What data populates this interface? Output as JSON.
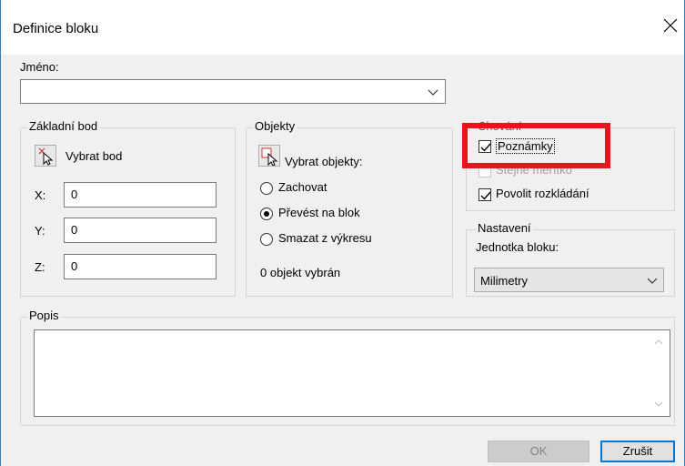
{
  "window": {
    "title": "Definice bloku",
    "close_icon": "close-icon"
  },
  "name_field": {
    "label": "Jméno:",
    "value": ""
  },
  "base_point": {
    "group_label": "Základní bod",
    "pick_label": "Vybrat bod",
    "x_label": "X:",
    "x_value": "0",
    "y_label": "Y:",
    "y_value": "0",
    "z_label": "Z:",
    "z_value": "0"
  },
  "objects": {
    "group_label": "Objekty",
    "select_label": "Vybrat objekty:",
    "options": [
      "Zachovat",
      "Převést na blok",
      "Smazat z výkresu"
    ],
    "selected_option": "Převést na blok",
    "status": "0 objekt vybrán"
  },
  "behavior": {
    "group_label": "Chování",
    "annotative_label": "Poznámky",
    "annotative_checked": true,
    "uniform_scale_label": "Stejné měřítko",
    "uniform_scale_enabled": false,
    "explode_label": "Povolit rozkládání",
    "explode_checked": true
  },
  "settings": {
    "group_label": "Nastavení",
    "unit_label": "Jednotka bloku:",
    "unit_value": "Milimetry"
  },
  "description": {
    "group_label": "Popis",
    "value": ""
  },
  "buttons": {
    "ok": "OK",
    "cancel": "Zrušit"
  },
  "colors": {
    "highlight": "#e8141c",
    "accent": "#0078d7"
  }
}
